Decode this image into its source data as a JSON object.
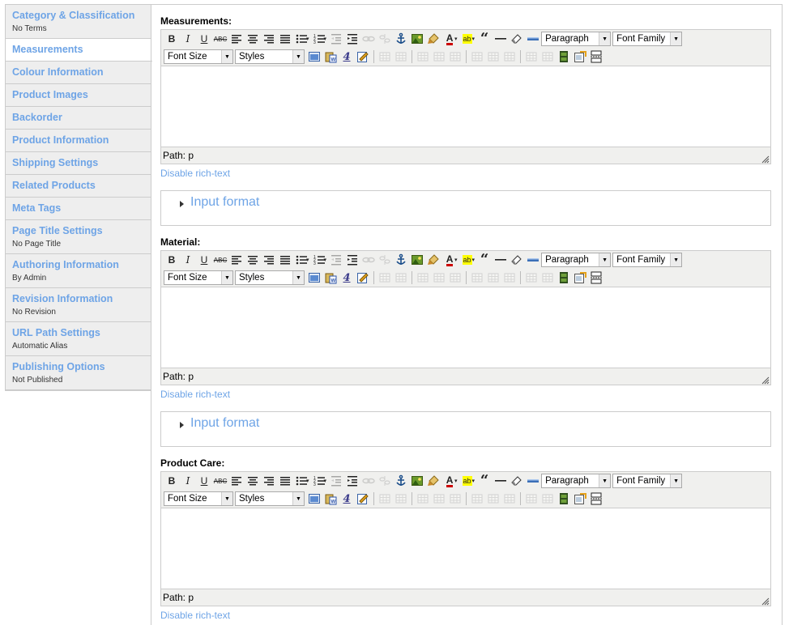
{
  "tabs": [
    {
      "title": "Category & Classification",
      "summary": "No Terms",
      "active": false
    },
    {
      "title": "Measurements",
      "summary": "",
      "active": true
    },
    {
      "title": "Colour Information",
      "summary": "",
      "active": false
    },
    {
      "title": "Product Images",
      "summary": "",
      "active": false
    },
    {
      "title": "Backorder",
      "summary": "",
      "active": false
    },
    {
      "title": "Product Information",
      "summary": "",
      "active": false
    },
    {
      "title": "Shipping Settings",
      "summary": "",
      "active": false
    },
    {
      "title": "Related Products",
      "summary": "",
      "active": false
    },
    {
      "title": "Meta Tags",
      "summary": "",
      "active": false
    },
    {
      "title": "Page Title Settings",
      "summary": "No Page Title",
      "active": false
    },
    {
      "title": "Authoring Information",
      "summary": "By Admin",
      "active": false
    },
    {
      "title": "Revision Information",
      "summary": "No Revision",
      "active": false
    },
    {
      "title": "URL Path Settings",
      "summary": "Automatic Alias",
      "active": false
    },
    {
      "title": "Publishing Options",
      "summary": "Not Published",
      "active": false
    }
  ],
  "fields": [
    {
      "label": "Measurements:",
      "path": "Path: p",
      "disable": "Disable rich-text",
      "input_format": "Input format"
    },
    {
      "label": "Material:",
      "path": "Path: p",
      "disable": "Disable rich-text",
      "input_format": "Input format"
    },
    {
      "label": "Product Care:",
      "path": "Path: p",
      "disable": "Disable rich-text"
    }
  ],
  "toolbar": {
    "paragraph": "Paragraph",
    "font_family": "Font Family",
    "font_size": "Font Size",
    "styles": "Styles",
    "bold": "B",
    "italic": "I",
    "underline": "U",
    "strike": "ABC",
    "color_a": "A",
    "highlight": "ab",
    "quote": "“",
    "icons_row1": [
      "bold-icon",
      "italic-icon",
      "underline-icon",
      "strikethrough-icon",
      "align-left-icon",
      "align-center-icon",
      "align-right-icon",
      "justify-icon",
      "bullet-list-icon",
      "numbered-list-icon",
      "outdent-icon",
      "indent-icon",
      "link-icon",
      "unlink-icon",
      "anchor-icon",
      "image-icon",
      "cleanup-icon",
      "text-color-icon",
      "highlight-icon",
      "blockquote-icon",
      "horizontal-rule-icon",
      "remove-format-icon",
      "visual-aid-icon"
    ],
    "icons_row2": [
      "insert-table-icon",
      "paste-word-icon",
      "char-map-icon",
      "edit-html-icon",
      "row-props-icon",
      "cell-props-icon",
      "insert-row-before-icon",
      "insert-row-after-icon",
      "delete-row-icon",
      "insert-col-before-icon",
      "insert-col-after-icon",
      "delete-col-icon",
      "split-cells-icon",
      "merge-cells-icon",
      "media-icon",
      "template-icon",
      "page-break-icon"
    ]
  }
}
